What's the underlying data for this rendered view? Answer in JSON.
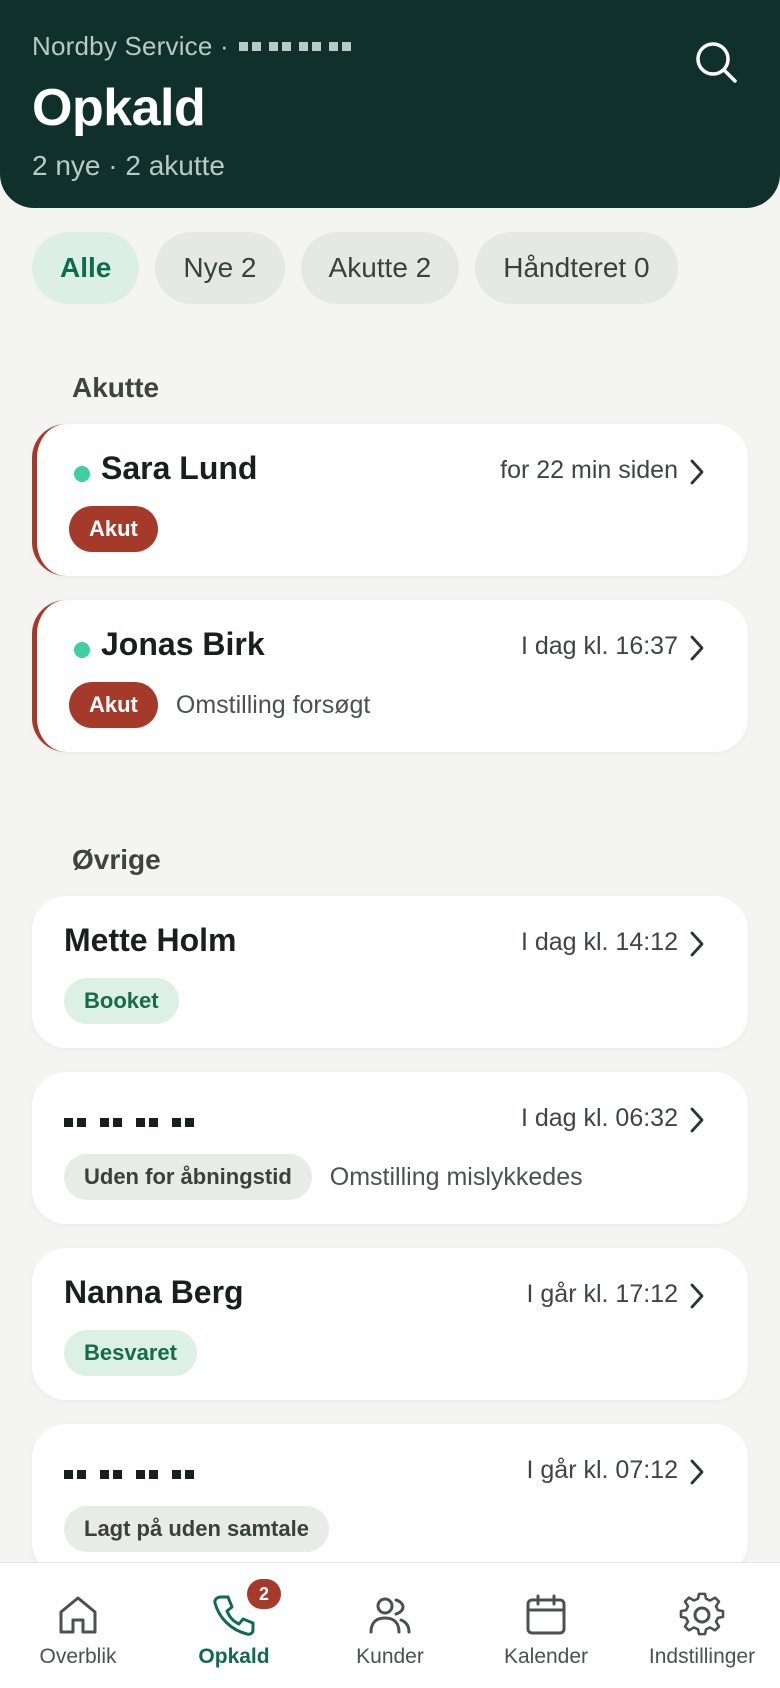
{
  "header": {
    "org": "Nordby Service ·",
    "title": "Opkald",
    "subtitle": "2 nye · 2 akutte"
  },
  "filters": [
    {
      "label": "Alle",
      "active": true
    },
    {
      "label": "Nye 2",
      "active": false
    },
    {
      "label": "Akutte 2",
      "active": false
    },
    {
      "label": "Håndteret 0",
      "active": false
    }
  ],
  "sections": {
    "urgent": "Akutte",
    "other": "Øvrige"
  },
  "calls": [
    {
      "name": "Sara Lund",
      "time": "for 22 min siden",
      "badge": "Akut",
      "note": "",
      "new": true
    },
    {
      "name": "Jonas Birk",
      "time": "I dag kl. 16:37",
      "badge": "Akut",
      "note": "Omstilling forsøgt",
      "new": true
    },
    {
      "name": "Mette Holm",
      "time": "I dag kl. 14:12",
      "badge": "Booket",
      "note": ""
    },
    {
      "name": "",
      "time": "I dag kl. 06:32",
      "badge": "Uden for åbningstid",
      "note": "Omstilling mislykkedes"
    },
    {
      "name": "Nanna Berg",
      "time": "I går kl. 17:12",
      "badge": "Besvaret",
      "note": ""
    },
    {
      "name": "",
      "time": "I går kl. 07:12",
      "badge": "Lagt på uden samtale",
      "note": ""
    }
  ],
  "nav": [
    {
      "label": "Overblik",
      "icon": "home-icon"
    },
    {
      "label": "Opkald",
      "icon": "phone-icon",
      "badge": "2",
      "active": true
    },
    {
      "label": "Kunder",
      "icon": "users-icon"
    },
    {
      "label": "Kalender",
      "icon": "calendar-icon"
    },
    {
      "label": "Indstillinger",
      "icon": "gear-icon"
    }
  ],
  "colors": {
    "header_bg": "#0f302b",
    "urgent": "#a63a2a",
    "accent_green": "#0f6b4d",
    "new_dot": "#3fcf9f"
  }
}
